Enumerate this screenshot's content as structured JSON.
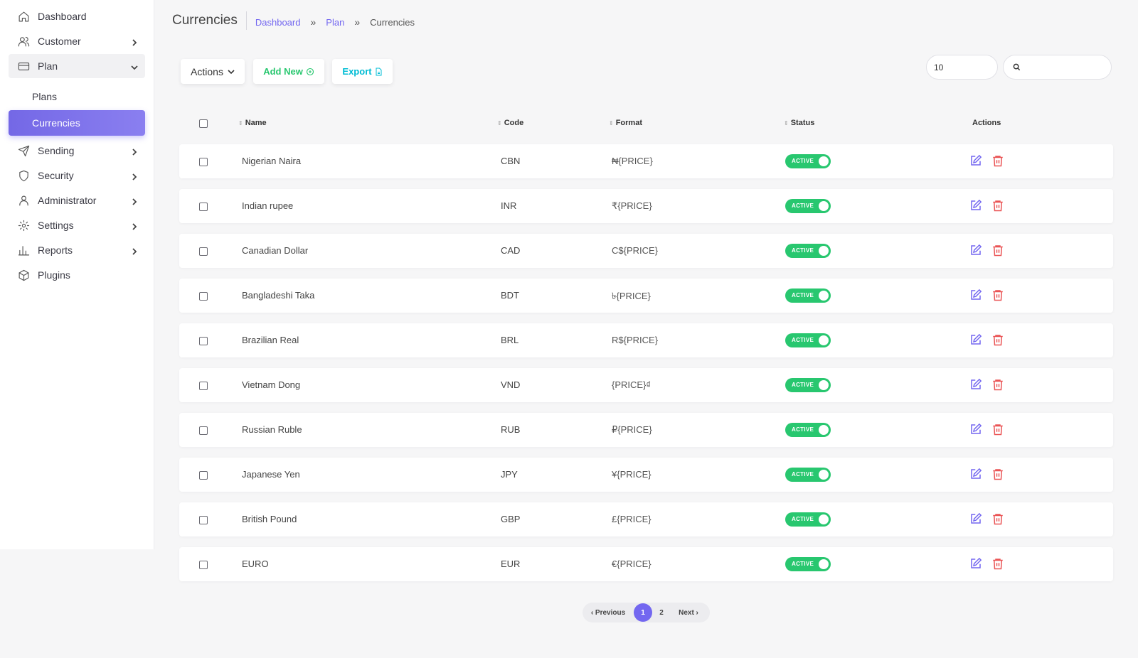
{
  "sidebar": {
    "items": [
      {
        "label": "Dashboard",
        "icon": "home-icon"
      },
      {
        "label": "Customer",
        "icon": "users-icon"
      },
      {
        "label": "Plan",
        "icon": "credit-card-icon"
      },
      {
        "label": "Sending",
        "icon": "send-icon"
      },
      {
        "label": "Security",
        "icon": "shield-icon"
      },
      {
        "label": "Administrator",
        "icon": "user-icon"
      },
      {
        "label": "Settings",
        "icon": "gear-icon"
      },
      {
        "label": "Reports",
        "icon": "bar-chart-icon"
      },
      {
        "label": "Plugins",
        "icon": "package-icon"
      }
    ],
    "plan_sub": [
      {
        "label": "Plans"
      },
      {
        "label": "Currencies",
        "active": true
      }
    ],
    "active_color": "#7367f0"
  },
  "header": {
    "title": "Currencies",
    "breadcrumb": [
      "Dashboard",
      "Plan",
      "Currencies"
    ],
    "separator": "»"
  },
  "toolbar": {
    "actions_label": "Actions",
    "add_label": "Add New",
    "export_label": "Export",
    "per_page": "10",
    "search_placeholder": ""
  },
  "table": {
    "columns": [
      "Name",
      "Code",
      "Format",
      "Status",
      "Actions"
    ],
    "rows": [
      {
        "name": "Nigerian Naira",
        "code": "CBN",
        "format": "₦{PRICE}",
        "status": "ACTIVE"
      },
      {
        "name": "Indian rupee",
        "code": "INR",
        "format": "₹{PRICE}",
        "status": "ACTIVE"
      },
      {
        "name": "Canadian Dollar",
        "code": "CAD",
        "format": "C${PRICE}",
        "status": "ACTIVE"
      },
      {
        "name": "Bangladeshi Taka",
        "code": "BDT",
        "format": "৳{PRICE}",
        "status": "ACTIVE"
      },
      {
        "name": "Brazilian Real",
        "code": "BRL",
        "format": "R${PRICE}",
        "status": "ACTIVE"
      },
      {
        "name": "Vietnam Dong",
        "code": "VND",
        "format": "{PRICE}₫",
        "status": "ACTIVE"
      },
      {
        "name": "Russian Ruble",
        "code": "RUB",
        "format": "₽{PRICE}",
        "status": "ACTIVE"
      },
      {
        "name": "Japanese Yen",
        "code": "JPY",
        "format": "¥{PRICE}",
        "status": "ACTIVE"
      },
      {
        "name": "British Pound",
        "code": "GBP",
        "format": "£{PRICE}",
        "status": "ACTIVE"
      },
      {
        "name": "EURO",
        "code": "EUR",
        "format": "€{PRICE}",
        "status": "ACTIVE"
      }
    ],
    "status_color": "#28c76f",
    "edit_color": "#7367f0",
    "delete_color": "#ea5455"
  },
  "pagination": {
    "prev": "Previous",
    "next": "Next",
    "pages": [
      "1",
      "2"
    ],
    "current": "1"
  }
}
